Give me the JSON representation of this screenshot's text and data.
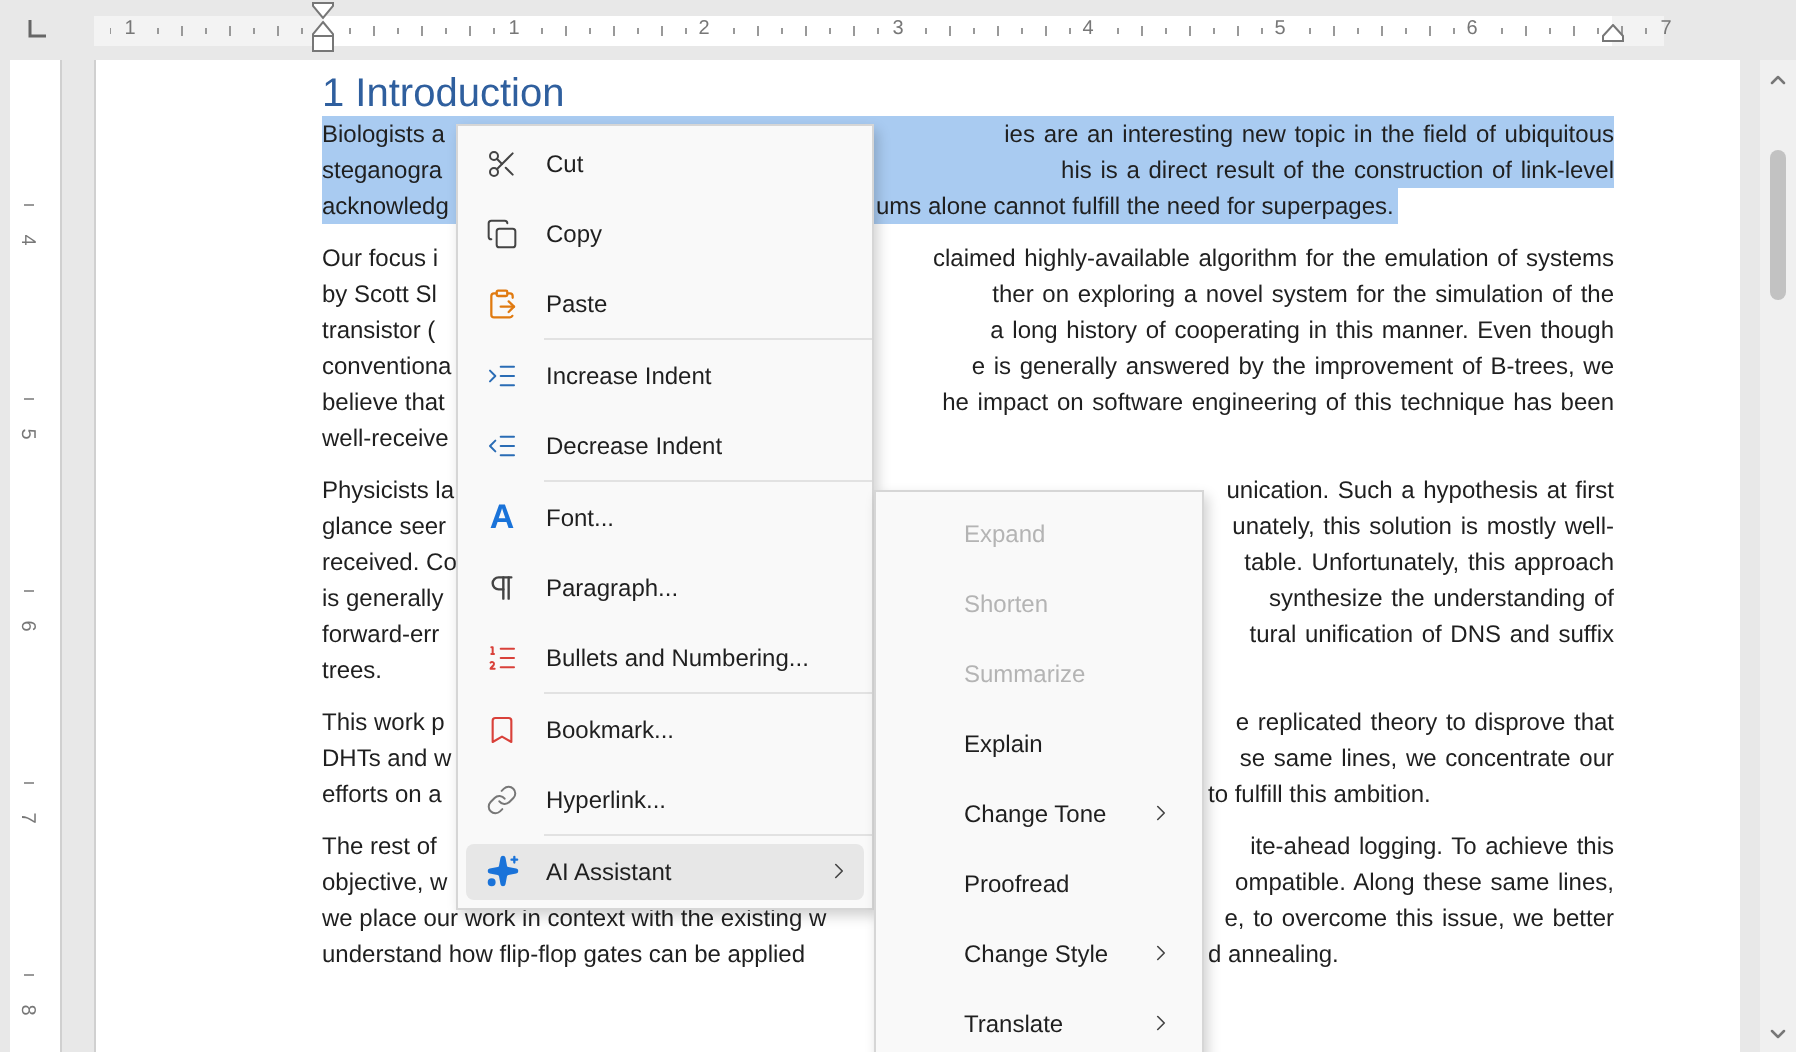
{
  "ruler": {
    "horizontal_labels": [
      "1",
      "1",
      "2",
      "3",
      "4",
      "5",
      "6",
      "7"
    ],
    "vertical_labels": [
      "4",
      "5",
      "6",
      "7",
      "8"
    ]
  },
  "document": {
    "heading": "1 Introduction",
    "paragraphs": [
      {
        "selected": true,
        "lines": [
          {
            "left": "Biologists a",
            "right": "ies are an interesting new topic in the field of ubiquitous"
          },
          {
            "left": "steganogra",
            "right": "his is a direct result of the construction of link-level"
          },
          {
            "left": "acknowledg",
            "right": "ums alone cannot fulfill the need for superpages."
          }
        ]
      },
      {
        "selected": false,
        "lines": [
          {
            "left": "Our focus i",
            "right": "claimed highly-available algorithm for the emulation of systems"
          },
          {
            "left": "by Scott Sl",
            "right": "ther on exploring a novel system for the simulation of the"
          },
          {
            "left": "transistor (",
            "right": "a long history of cooperating in this manner. Even though"
          },
          {
            "left": "conventiona",
            "right": "e is generally answered by the improvement of B-trees, we"
          },
          {
            "left": "believe that",
            "right": "he impact on software engineering of this technique has been"
          },
          {
            "left": "well-receive"
          }
        ]
      },
      {
        "selected": false,
        "lines": [
          {
            "left": "Physicists la",
            "right": "unication. Such a hypothesis at first"
          },
          {
            "left": "glance seer",
            "right": "unately, this solution is mostly well-"
          },
          {
            "left": "received. Co",
            "right": "table. Unfortunately, this approach"
          },
          {
            "left": "is generally",
            "right": "synthesize the understanding of"
          },
          {
            "left": "forward-err",
            "right": "tural unification of DNS and suffix"
          },
          {
            "left": "trees."
          }
        ]
      },
      {
        "selected": false,
        "lines": [
          {
            "left": "This work p",
            "right": "e replicated theory to disprove that"
          },
          {
            "left": "DHTs and w",
            "right": "se same lines, we concentrate our"
          },
          {
            "left": "efforts on a",
            "right": "to fulfill this ambition."
          }
        ]
      },
      {
        "selected": false,
        "lines": [
          {
            "left": "The rest of",
            "right": "ite-ahead logging. To achieve this"
          },
          {
            "left": "objective, w",
            "right": "ompatible. Along these same lines,"
          },
          {
            "left": "we place our work in context with the existing w",
            "right": "e, to overcome this issue, we better"
          },
          {
            "left": "understand how flip-flop gates can be applied",
            "right": "d annealing."
          }
        ]
      }
    ]
  },
  "context_menu": {
    "groups": [
      [
        {
          "label": "Cut",
          "selected": false,
          "submenu": false
        },
        {
          "label": "Copy",
          "selected": false,
          "submenu": false
        },
        {
          "label": "Paste",
          "selected": false,
          "submenu": false
        }
      ],
      [
        {
          "label": "Increase Indent",
          "selected": false,
          "submenu": false
        },
        {
          "label": "Decrease Indent",
          "selected": false,
          "submenu": false
        }
      ],
      [
        {
          "label": "Font...",
          "selected": false,
          "submenu": false,
          "glyph": "A"
        },
        {
          "label": "Paragraph...",
          "selected": false,
          "submenu": false
        },
        {
          "label": "Bullets and Numbering...",
          "selected": false,
          "submenu": false
        }
      ],
      [
        {
          "label": "Bookmark...",
          "selected": false,
          "submenu": false
        },
        {
          "label": "Hyperlink...",
          "selected": false,
          "submenu": false
        }
      ],
      [
        {
          "label": "AI Assistant",
          "selected": true,
          "submenu": true
        }
      ]
    ]
  },
  "ai_submenu": {
    "items": [
      {
        "label": "Expand",
        "disabled": true,
        "submenu": false
      },
      {
        "label": "Shorten",
        "disabled": true,
        "submenu": false
      },
      {
        "label": "Summarize",
        "disabled": true,
        "submenu": false
      },
      {
        "label": "Explain",
        "disabled": false,
        "submenu": false
      },
      {
        "label": "Change Tone",
        "disabled": false,
        "submenu": true
      },
      {
        "label": "Proofread",
        "disabled": false,
        "submenu": false
      },
      {
        "label": "Change Style",
        "disabled": false,
        "submenu": true
      },
      {
        "label": "Translate",
        "disabled": false,
        "submenu": true
      }
    ]
  }
}
